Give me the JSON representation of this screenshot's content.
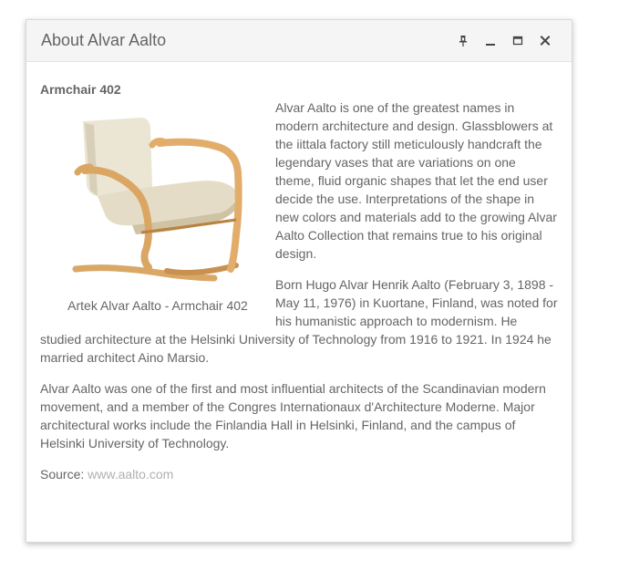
{
  "window": {
    "title": "About Alvar Aalto",
    "actions": [
      "pin-icon",
      "minimize-icon",
      "maximize-icon",
      "close-icon"
    ]
  },
  "article": {
    "heading": "Armchair 402",
    "caption": "Artek Alvar Aalto - Armchair 402",
    "paragraphs": [
      "Alvar Aalto is one of the greatest names in modern architecture and design. Glassblowers at the iittala factory still meticulously handcraft the legendary vases that are variations on one theme, fluid organic shapes that let the end user decide the use. Interpretations of the shape in new colors and materials add to the growing Alvar Aalto Collection that remains true to his original design.",
      "Born Hugo Alvar Henrik Aalto (February 3, 1898 - May 11, 1976) in Kuortane, Finland, was noted for his humanistic approach to modernism. He studied architecture at the Helsinki University of Technology from 1916 to 1921. In 1924 he married architect Aino Marsio.",
      "Alvar Aalto was one of the first and most influential architects of the Scandinavian modern movement, and a member of the Congres Internationaux d'Architecture Moderne. Major architectural works include the Finlandia Hall in Helsinki, Finland, and the campus of Helsinki University of Technology."
    ],
    "source_label": "Source:",
    "source_link": "www.aalto.com"
  },
  "colors": {
    "text": "#656565",
    "link": "#b0b0b0",
    "titlebar": "#f5f5f5"
  }
}
